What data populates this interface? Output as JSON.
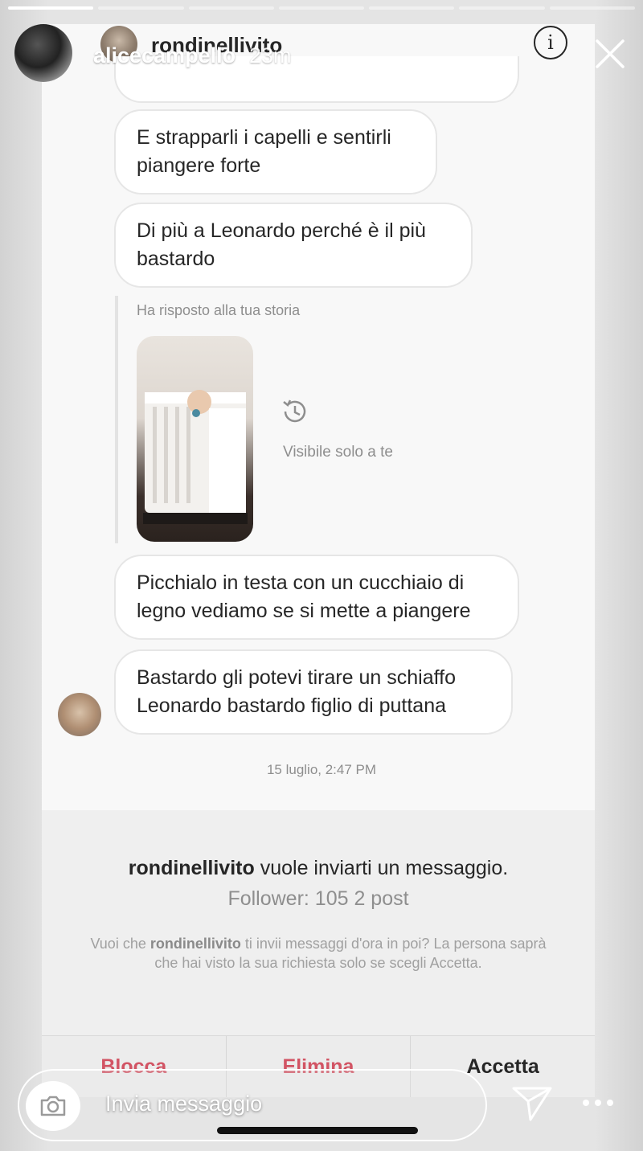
{
  "story": {
    "username": "alicecampello",
    "time": "23m",
    "progress_segments": 7,
    "completed_segments": 1,
    "reply_placeholder": "Invia messaggio"
  },
  "dm": {
    "username": "rondinellivito",
    "messages": [
      "E strapparli i capelli e sentirli piangere forte",
      "Di più a Leonardo perché è il più bastardo"
    ],
    "story_reply_label": "Ha risposto alla tua storia",
    "visible_note": "Visibile solo a te",
    "messages_after": [
      "Picchialo in testa con un cucchiaio di legno vediamo se si mette a piangere",
      "Bastardo gli potevi tirare un schiaffo Leonardo bastardo figlio di puttana"
    ],
    "timestamp": "15 luglio, 2:47 PM"
  },
  "request": {
    "username": "rondinellivito",
    "title_suffix": "vuole inviarti un messaggio.",
    "stats": "Follower: 105 2 post",
    "desc_prefix": "Vuoi che",
    "desc_user": "rondinellivito",
    "desc_suffix": "ti invii messaggi d'ora in poi? La persona saprà che hai visto la sua richiesta solo se scegli Accetta.",
    "actions": [
      "Blocca",
      "Elimina",
      "Accetta"
    ]
  },
  "colors": {
    "danger": "#d25464",
    "text": "#262626",
    "muted": "#8e8e8e"
  }
}
